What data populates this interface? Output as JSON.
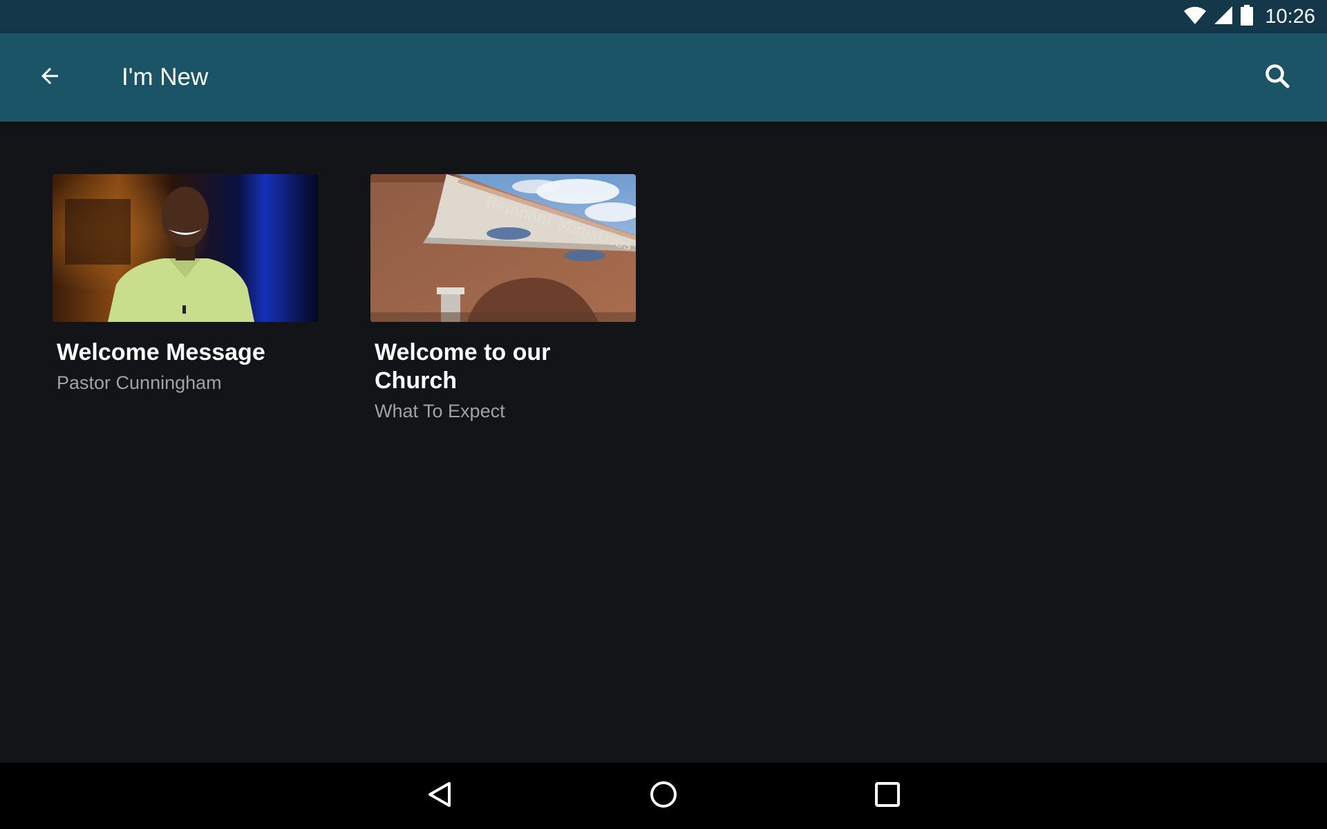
{
  "status_bar": {
    "time": "10:26",
    "icons": [
      "wifi-icon",
      "cell-signal-icon",
      "battery-icon"
    ]
  },
  "app_bar": {
    "title": "I'm New",
    "back_icon": "arrow-back-icon",
    "search_icon": "search-icon",
    "background": "#1c5467"
  },
  "cards": [
    {
      "title": "Welcome Message",
      "subtitle": "Pastor Cunningham",
      "thumbnail": "pastor-video-thumbnail"
    },
    {
      "title": "Welcome to our Church",
      "subtitle": "What To Expect",
      "thumbnail": "church-building-thumbnail",
      "thumbnail_text": "Remnant Ministries"
    }
  ],
  "nav_bar": {
    "icons": [
      "nav-back-icon",
      "nav-home-icon",
      "nav-recents-icon"
    ]
  },
  "colors": {
    "background": "#131417",
    "status_bar": "#15374a",
    "subtitle": "#a0a2a5"
  }
}
